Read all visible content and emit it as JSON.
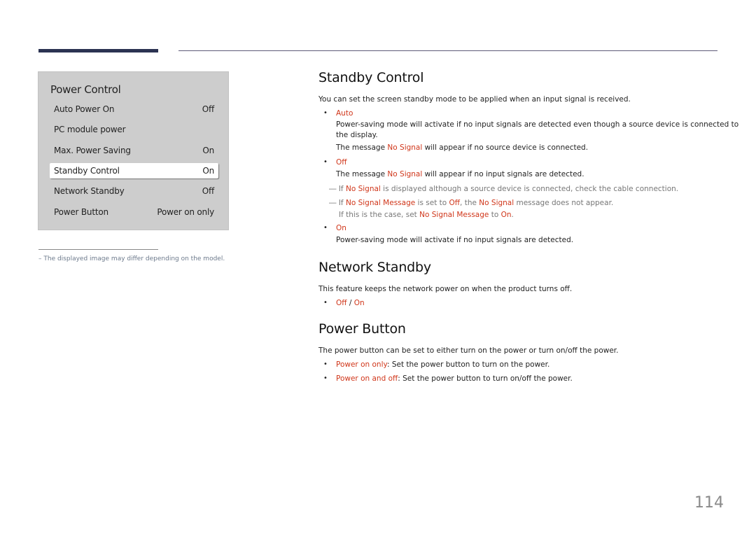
{
  "osd": {
    "title": "Power Control",
    "items": [
      {
        "label": "Auto Power On",
        "value": "Off"
      },
      {
        "label": "PC module power",
        "value": ""
      },
      {
        "label": "Max. Power Saving",
        "value": "On"
      },
      {
        "label": "Standby Control",
        "value": "On",
        "selected": true
      },
      {
        "label": "Network Standby",
        "value": "Off"
      },
      {
        "label": "Power Button",
        "value": "Power on only"
      }
    ]
  },
  "footnote": "–  The displayed image may differ depending on the model.",
  "standby": {
    "title": "Standby Control",
    "intro": "You can set the screen standby mode to be applied when an input signal is received.",
    "auto_label": "Auto",
    "auto_desc_1": "Power-saving mode will activate if no input signals are detected even though a source device is connected to",
    "auto_desc_2": "the display.",
    "auto_msg_pre": "The message ",
    "auto_msg_red": "No Signal",
    "auto_msg_post": " will appear if no source device is connected.",
    "off_label": "Off",
    "off_msg_pre": "The message ",
    "off_msg_red": "No Signal",
    "off_msg_post": " will appear if no input signals are detected.",
    "note1_pre": "― If ",
    "note1_red": "No Signal",
    "note1_post": " is displayed although a source device is connected, check the cable connection.",
    "note2_pre": "― If ",
    "note2_red1": "No Signal Message",
    "note2_mid1": " is set to ",
    "note2_red2": "Off",
    "note2_mid2": ", the ",
    "note2_red3": "No Signal",
    "note2_post": " message does not appear.",
    "note3_pre": "If this is the case, set ",
    "note3_red1": "No Signal Message",
    "note3_mid": " to ",
    "note3_red2": "On",
    "note3_post": ".",
    "on_label": "On",
    "on_desc": "Power-saving mode will activate if no input signals are detected."
  },
  "network": {
    "title": "Network Standby",
    "intro": "This feature keeps the network power on when the product turns off.",
    "opt_off": "Off",
    "sep": " / ",
    "opt_on": "On"
  },
  "power_button": {
    "title": "Power Button",
    "intro": "The power button can be set to either turn on the power or turn on/off the power.",
    "opt1_label": "Power on only",
    "opt1_desc": ": Set the power button to turn on the power.",
    "opt2_label": "Power on and off",
    "opt2_desc": ": Set the power button to turn on/off the power."
  },
  "bullet_glyph": "•",
  "page_number": "114"
}
